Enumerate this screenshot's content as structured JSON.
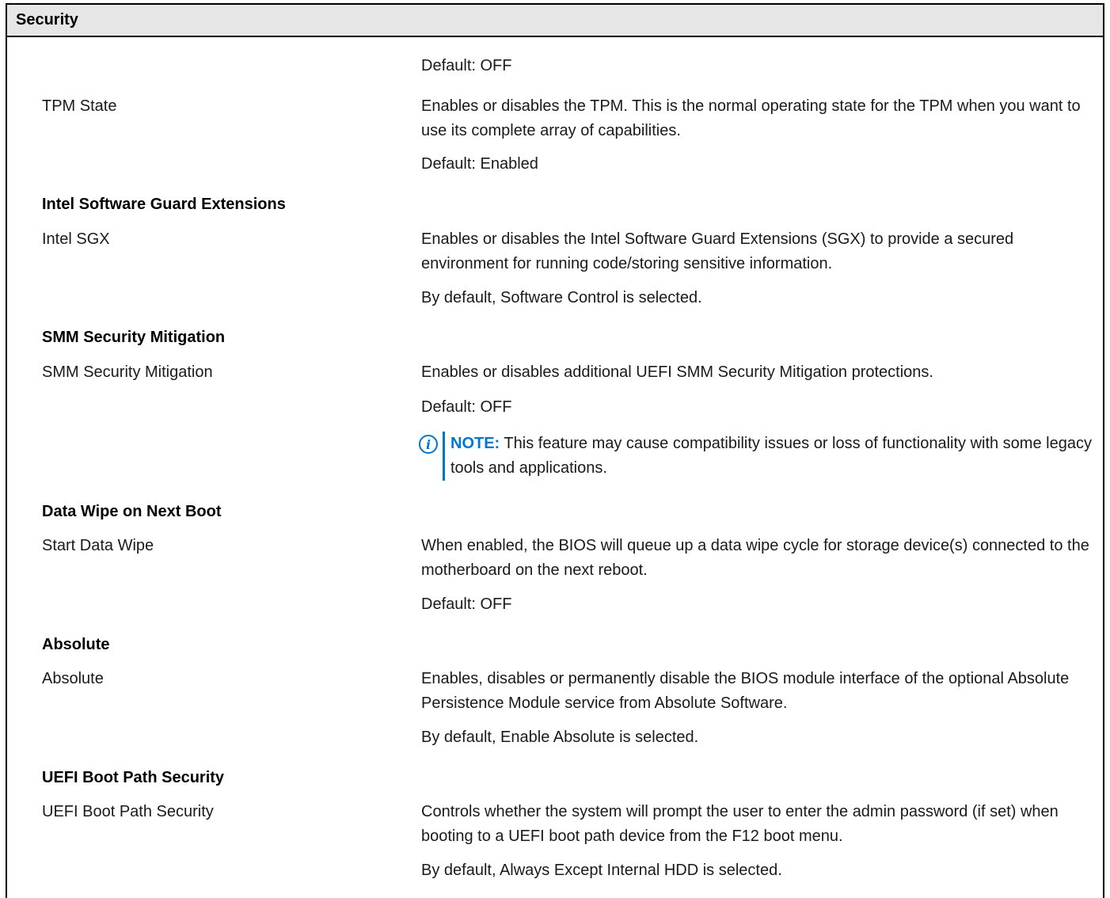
{
  "table": {
    "header": "Security",
    "items": [
      {
        "kind": "desc",
        "text": "Default: OFF"
      },
      {
        "kind": "label",
        "text": "TPM State"
      },
      {
        "kind": "desc",
        "text": "Enables or disables the TPM. This is the normal operating state for the TPM when you want to use its complete array of capabilities."
      },
      {
        "kind": "desc",
        "text": "Default: Enabled"
      },
      {
        "kind": "heading",
        "text": "Intel Software Guard Extensions"
      },
      {
        "kind": "label",
        "text": "Intel SGX"
      },
      {
        "kind": "desc",
        "text": "Enables or disables the Intel Software Guard Extensions (SGX) to provide a secured environment for running code/storing sensitive information."
      },
      {
        "kind": "desc",
        "text": "By default, Software Control is selected."
      },
      {
        "kind": "heading",
        "text": "SMM Security Mitigation"
      },
      {
        "kind": "label",
        "text": "SMM Security Mitigation"
      },
      {
        "kind": "desc",
        "text": "Enables or disables additional UEFI SMM Security Mitigation protections."
      },
      {
        "kind": "desc",
        "text": "Default: OFF"
      },
      {
        "kind": "note",
        "label": "NOTE:",
        "text": "This feature may cause compatibility issues or loss of functionality with some legacy tools and applications."
      },
      {
        "kind": "heading",
        "text": "Data Wipe on Next Boot"
      },
      {
        "kind": "label",
        "text": "Start Data Wipe"
      },
      {
        "kind": "desc",
        "text": "When enabled, the BIOS will queue up a data wipe cycle for storage device(s) connected to the motherboard on the next reboot."
      },
      {
        "kind": "desc",
        "text": "Default: OFF"
      },
      {
        "kind": "heading",
        "text": "Absolute"
      },
      {
        "kind": "label",
        "text": "Absolute"
      },
      {
        "kind": "desc",
        "text": "Enables, disables or permanently disable the BIOS module interface of the optional Absolute Persistence Module service from Absolute Software."
      },
      {
        "kind": "desc",
        "text": "By default, Enable Absolute is selected."
      },
      {
        "kind": "heading",
        "text": "UEFI Boot Path Security"
      },
      {
        "kind": "label",
        "text": "UEFI Boot Path Security"
      },
      {
        "kind": "desc",
        "text": "Controls whether the system will prompt the user to enter the admin password (if set) when booting to a UEFI boot path device from the F12 boot menu."
      },
      {
        "kind": "desc",
        "text": "By default, Always Except Internal HDD is selected."
      }
    ]
  },
  "note_icon": "info-icon",
  "accent_color": "#0076ce"
}
